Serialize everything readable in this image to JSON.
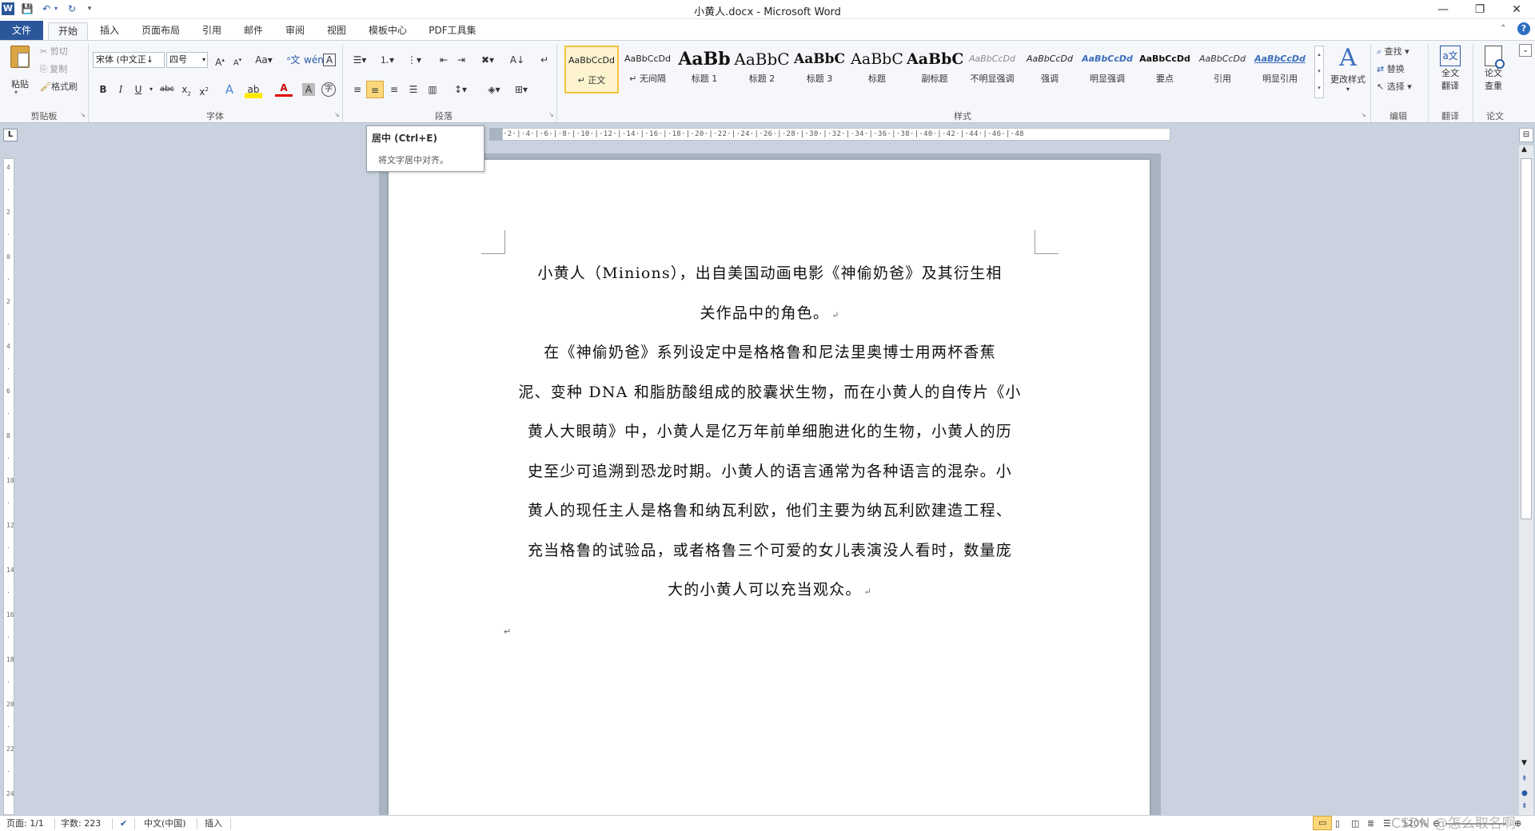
{
  "window": {
    "title": "小黄人.docx - Microsoft Word",
    "app_icon": "W",
    "qat_icons": [
      "save-icon",
      "undo-icon",
      "redo-icon",
      "customize-icon"
    ],
    "controls": [
      "minimize",
      "restore",
      "close"
    ]
  },
  "tabs": [
    "文件",
    "开始",
    "插入",
    "页面布局",
    "引用",
    "邮件",
    "审阅",
    "视图",
    "模板中心",
    "PDF工具集"
  ],
  "active_tab": "开始",
  "ribbon": {
    "clipboard": {
      "paste": "粘贴",
      "cut": "剪切",
      "copy": "复制",
      "format_painter": "格式刷",
      "label": "剪贴板"
    },
    "font": {
      "font_name": "宋体 (中文正↓",
      "font_size": "四号",
      "label": "字体"
    },
    "paragraph": {
      "label": "段落"
    },
    "styles": {
      "items": [
        {
          "sample": "AaBbCcDd",
          "name": "↵ 正文"
        },
        {
          "sample": "AaBbCcDd",
          "name": "↵ 无间隔"
        },
        {
          "sample": "AaBb",
          "name": "标题 1"
        },
        {
          "sample": "AaBbC",
          "name": "标题 2"
        },
        {
          "sample": "AaBbC",
          "name": "标题 3"
        },
        {
          "sample": "AaBbC",
          "name": "标题"
        },
        {
          "sample": "AaBbC",
          "name": "副标题"
        },
        {
          "sample": "AaBbCcDd",
          "name": "不明显强调"
        },
        {
          "sample": "AaBbCcDd",
          "name": "强调"
        },
        {
          "sample": "AaBbCcDd",
          "name": "明显强调"
        },
        {
          "sample": "AaBbCcDd",
          "name": "要点"
        },
        {
          "sample": "AaBbCcDd",
          "name": "引用"
        },
        {
          "sample": "AaBbCcDd",
          "name": "明显引用"
        }
      ],
      "change_styles_l1": "更改样式",
      "label": "样式"
    },
    "editing": {
      "find": "查找",
      "replace": "替换",
      "select": "选择",
      "label": "编辑"
    },
    "translate": {
      "full_text_l1": "全文",
      "full_text_l2": "翻译",
      "label": "翻译"
    },
    "paper": {
      "check_l1": "论文",
      "check_l2": "查重",
      "label": "论文"
    }
  },
  "tooltip": {
    "title": "居中 (Ctrl+E)",
    "description": "将文字居中对齐。"
  },
  "ruler": {
    "corner": "L",
    "top_marks": "·2·|·4·|·6·|·8·|·10·|·12·|·14·|·16·|·18·|·20·|·22·|·24·|·26·|·28·|·30·|·32·|·34·|·36·|·38·|·40·|·42·|·44·|·46·|·48"
  },
  "document": {
    "paragraphs": [
      {
        "lines": [
          "小黄人（Minions），出自美国动画电影《神偷奶爸》及其衍生相",
          "关作品中的角色。"
        ],
        "align": "center"
      },
      {
        "lines": [
          "在《神偷奶爸》系列设定中是格格鲁和尼法里奥博士用两杯香蕉",
          "泥、变种 DNA 和脂肪酸组成的胶囊状生物，而在小黄人的自传片《小",
          "黄人大眼萌》中，小黄人是亿万年前单细胞进化的生物，小黄人的历",
          "史至少可追溯到恐龙时期。小黄人的语言通常为各种语言的混杂。小",
          "黄人的现任主人是格鲁和纳瓦利欧，他们主要为纳瓦利欧建造工程、",
          "充当格鲁的试验品，或者格鲁三个可爱的女儿表演没人看时，数量庞",
          "大的小黄人可以充当观众。"
        ],
        "align": "center"
      }
    ],
    "mark": "↵"
  },
  "status_bar": {
    "page": "页面: 1/1",
    "word_count": "字数: 223",
    "language": "中文(中国)",
    "mode": "插入",
    "zoom": "120%",
    "watermark": "CSDN @怎么取名啊"
  }
}
